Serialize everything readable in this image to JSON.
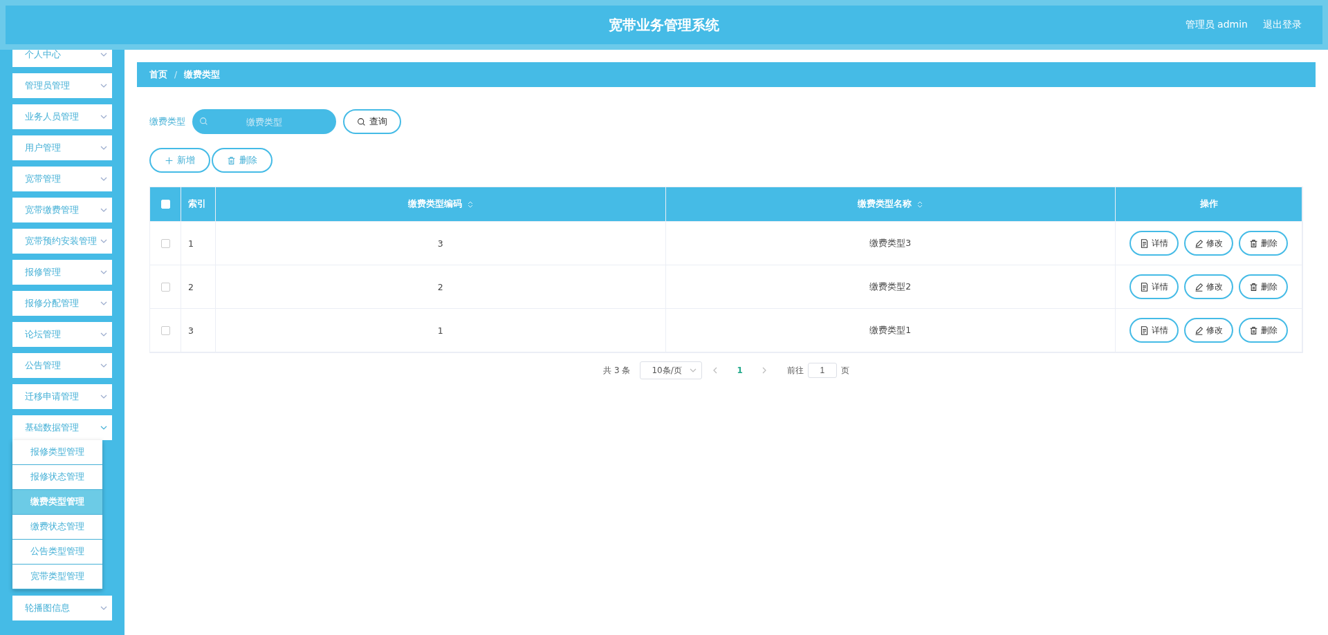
{
  "header": {
    "title": "宽带业务管理系统",
    "user": "管理员 admin",
    "logout": "退出登录"
  },
  "sidebar": {
    "items": [
      {
        "label": "个人中心",
        "expanded": false
      },
      {
        "label": "管理员管理",
        "expanded": false
      },
      {
        "label": "业务人员管理",
        "expanded": false
      },
      {
        "label": "用户管理",
        "expanded": false
      },
      {
        "label": "宽带管理",
        "expanded": false
      },
      {
        "label": "宽带缴费管理",
        "expanded": false
      },
      {
        "label": "宽带预约安装管理",
        "expanded": false
      },
      {
        "label": "报修管理",
        "expanded": false
      },
      {
        "label": "报修分配管理",
        "expanded": false
      },
      {
        "label": "论坛管理",
        "expanded": false
      },
      {
        "label": "公告管理",
        "expanded": false
      },
      {
        "label": "迁移申请管理",
        "expanded": false
      },
      {
        "label": "基础数据管理",
        "expanded": true,
        "children": [
          {
            "label": "报修类型管理",
            "selected": false
          },
          {
            "label": "报修状态管理",
            "selected": false
          },
          {
            "label": "缴费类型管理",
            "selected": true
          },
          {
            "label": "缴费状态管理",
            "selected": false
          },
          {
            "label": "公告类型管理",
            "selected": false
          },
          {
            "label": "宽带类型管理",
            "selected": false
          }
        ]
      },
      {
        "label": "轮播图信息",
        "expanded": false
      }
    ]
  },
  "breadcrumb": {
    "separator": "/",
    "items": [
      "首页",
      "缴费类型"
    ]
  },
  "search": {
    "label": "缴费类型",
    "placeholder": "缴费类型",
    "button": "查询"
  },
  "actions": [
    {
      "kind": "add",
      "label": "新增"
    },
    {
      "kind": "delete",
      "label": "删除"
    }
  ],
  "table": {
    "header_checked": false,
    "columns": [
      {
        "label": "索引",
        "sortable": false
      },
      {
        "label": "缴费类型编码",
        "sortable": true
      },
      {
        "label": "缴费类型名称",
        "sortable": true
      },
      {
        "label": "操作",
        "sortable": false
      }
    ],
    "rows": [
      {
        "checked": false,
        "index": "1",
        "code": "3",
        "name": "缴费类型3",
        "actions": [
          {
            "kind": "detail",
            "label": "详情"
          },
          {
            "kind": "edit",
            "label": "修改"
          },
          {
            "kind": "delete",
            "label": "删除"
          }
        ]
      },
      {
        "checked": false,
        "index": "2",
        "code": "2",
        "name": "缴费类型2",
        "actions": [
          {
            "kind": "detail",
            "label": "详情"
          },
          {
            "kind": "edit",
            "label": "修改"
          },
          {
            "kind": "delete",
            "label": "删除"
          }
        ]
      },
      {
        "checked": false,
        "index": "3",
        "code": "1",
        "name": "缴费类型1",
        "actions": [
          {
            "kind": "detail",
            "label": "详情"
          },
          {
            "kind": "edit",
            "label": "修改"
          },
          {
            "kind": "delete",
            "label": "删除"
          }
        ]
      }
    ]
  },
  "pagination": {
    "total": "共 3 条",
    "page_size": "10条/页",
    "pages": [
      {
        "label": "1",
        "selected": true
      }
    ],
    "goto_label": "前往",
    "goto_value": "1",
    "goto_suffix": "页"
  }
}
